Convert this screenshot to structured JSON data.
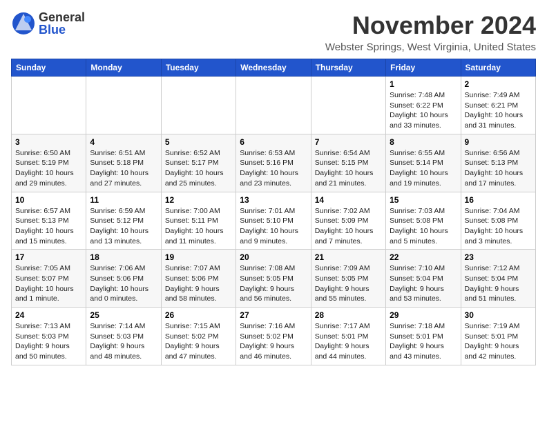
{
  "header": {
    "logo_general": "General",
    "logo_blue": "Blue",
    "month_title": "November 2024",
    "location": "Webster Springs, West Virginia, United States"
  },
  "weekdays": [
    "Sunday",
    "Monday",
    "Tuesday",
    "Wednesday",
    "Thursday",
    "Friday",
    "Saturday"
  ],
  "weeks": [
    [
      {
        "day": "",
        "detail": ""
      },
      {
        "day": "",
        "detail": ""
      },
      {
        "day": "",
        "detail": ""
      },
      {
        "day": "",
        "detail": ""
      },
      {
        "day": "",
        "detail": ""
      },
      {
        "day": "1",
        "detail": "Sunrise: 7:48 AM\nSunset: 6:22 PM\nDaylight: 10 hours\nand 33 minutes."
      },
      {
        "day": "2",
        "detail": "Sunrise: 7:49 AM\nSunset: 6:21 PM\nDaylight: 10 hours\nand 31 minutes."
      }
    ],
    [
      {
        "day": "3",
        "detail": "Sunrise: 6:50 AM\nSunset: 5:19 PM\nDaylight: 10 hours\nand 29 minutes."
      },
      {
        "day": "4",
        "detail": "Sunrise: 6:51 AM\nSunset: 5:18 PM\nDaylight: 10 hours\nand 27 minutes."
      },
      {
        "day": "5",
        "detail": "Sunrise: 6:52 AM\nSunset: 5:17 PM\nDaylight: 10 hours\nand 25 minutes."
      },
      {
        "day": "6",
        "detail": "Sunrise: 6:53 AM\nSunset: 5:16 PM\nDaylight: 10 hours\nand 23 minutes."
      },
      {
        "day": "7",
        "detail": "Sunrise: 6:54 AM\nSunset: 5:15 PM\nDaylight: 10 hours\nand 21 minutes."
      },
      {
        "day": "8",
        "detail": "Sunrise: 6:55 AM\nSunset: 5:14 PM\nDaylight: 10 hours\nand 19 minutes."
      },
      {
        "day": "9",
        "detail": "Sunrise: 6:56 AM\nSunset: 5:13 PM\nDaylight: 10 hours\nand 17 minutes."
      }
    ],
    [
      {
        "day": "10",
        "detail": "Sunrise: 6:57 AM\nSunset: 5:13 PM\nDaylight: 10 hours\nand 15 minutes."
      },
      {
        "day": "11",
        "detail": "Sunrise: 6:59 AM\nSunset: 5:12 PM\nDaylight: 10 hours\nand 13 minutes."
      },
      {
        "day": "12",
        "detail": "Sunrise: 7:00 AM\nSunset: 5:11 PM\nDaylight: 10 hours\nand 11 minutes."
      },
      {
        "day": "13",
        "detail": "Sunrise: 7:01 AM\nSunset: 5:10 PM\nDaylight: 10 hours\nand 9 minutes."
      },
      {
        "day": "14",
        "detail": "Sunrise: 7:02 AM\nSunset: 5:09 PM\nDaylight: 10 hours\nand 7 minutes."
      },
      {
        "day": "15",
        "detail": "Sunrise: 7:03 AM\nSunset: 5:08 PM\nDaylight: 10 hours\nand 5 minutes."
      },
      {
        "day": "16",
        "detail": "Sunrise: 7:04 AM\nSunset: 5:08 PM\nDaylight: 10 hours\nand 3 minutes."
      }
    ],
    [
      {
        "day": "17",
        "detail": "Sunrise: 7:05 AM\nSunset: 5:07 PM\nDaylight: 10 hours\nand 1 minute."
      },
      {
        "day": "18",
        "detail": "Sunrise: 7:06 AM\nSunset: 5:06 PM\nDaylight: 10 hours\nand 0 minutes."
      },
      {
        "day": "19",
        "detail": "Sunrise: 7:07 AM\nSunset: 5:06 PM\nDaylight: 9 hours\nand 58 minutes."
      },
      {
        "day": "20",
        "detail": "Sunrise: 7:08 AM\nSunset: 5:05 PM\nDaylight: 9 hours\nand 56 minutes."
      },
      {
        "day": "21",
        "detail": "Sunrise: 7:09 AM\nSunset: 5:05 PM\nDaylight: 9 hours\nand 55 minutes."
      },
      {
        "day": "22",
        "detail": "Sunrise: 7:10 AM\nSunset: 5:04 PM\nDaylight: 9 hours\nand 53 minutes."
      },
      {
        "day": "23",
        "detail": "Sunrise: 7:12 AM\nSunset: 5:04 PM\nDaylight: 9 hours\nand 51 minutes."
      }
    ],
    [
      {
        "day": "24",
        "detail": "Sunrise: 7:13 AM\nSunset: 5:03 PM\nDaylight: 9 hours\nand 50 minutes."
      },
      {
        "day": "25",
        "detail": "Sunrise: 7:14 AM\nSunset: 5:03 PM\nDaylight: 9 hours\nand 48 minutes."
      },
      {
        "day": "26",
        "detail": "Sunrise: 7:15 AM\nSunset: 5:02 PM\nDaylight: 9 hours\nand 47 minutes."
      },
      {
        "day": "27",
        "detail": "Sunrise: 7:16 AM\nSunset: 5:02 PM\nDaylight: 9 hours\nand 46 minutes."
      },
      {
        "day": "28",
        "detail": "Sunrise: 7:17 AM\nSunset: 5:01 PM\nDaylight: 9 hours\nand 44 minutes."
      },
      {
        "day": "29",
        "detail": "Sunrise: 7:18 AM\nSunset: 5:01 PM\nDaylight: 9 hours\nand 43 minutes."
      },
      {
        "day": "30",
        "detail": "Sunrise: 7:19 AM\nSunset: 5:01 PM\nDaylight: 9 hours\nand 42 minutes."
      }
    ]
  ]
}
